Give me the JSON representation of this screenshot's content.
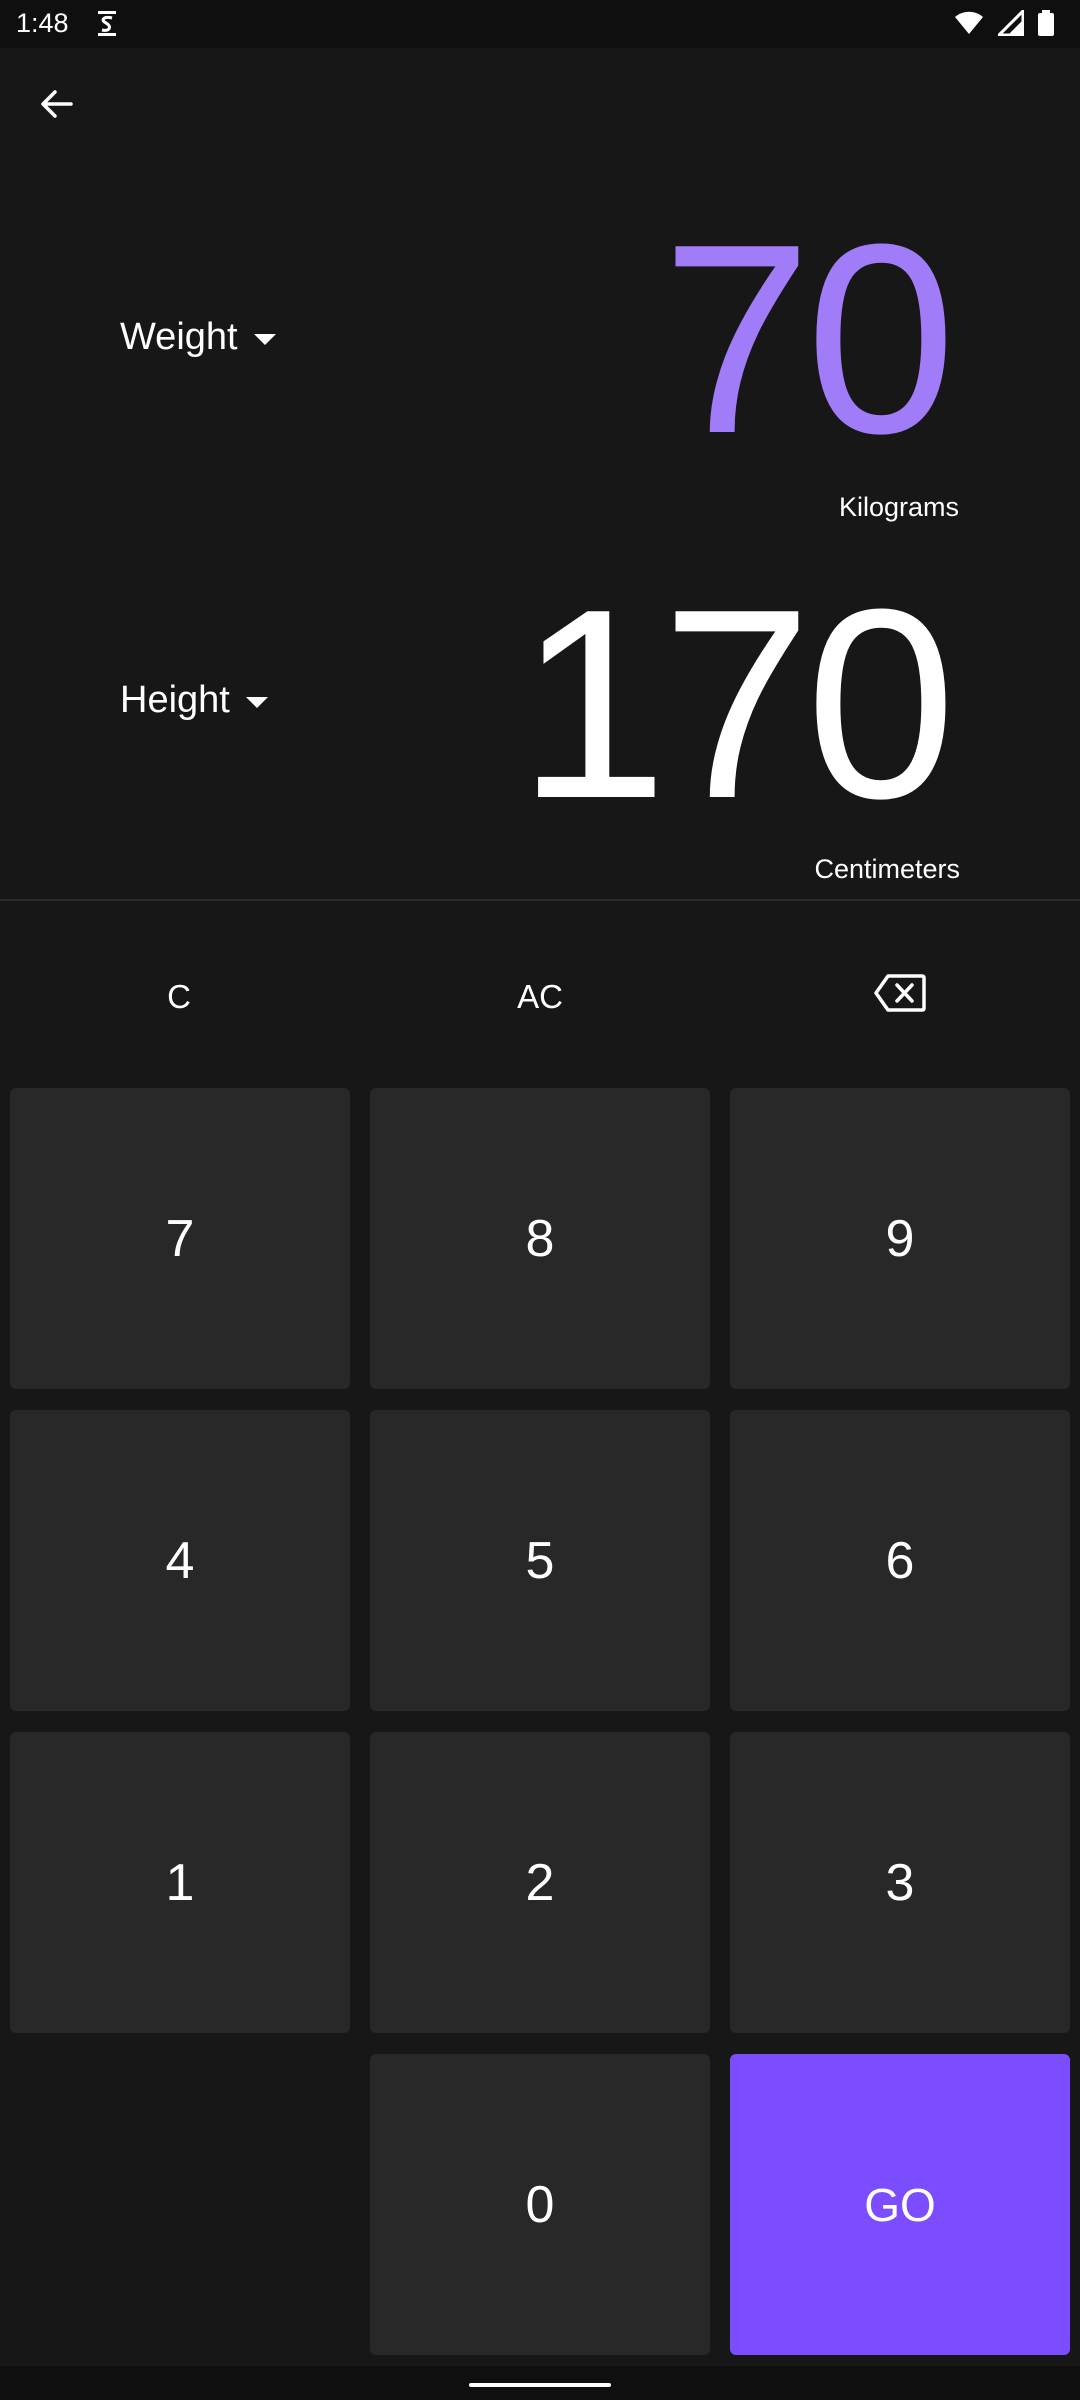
{
  "status_bar": {
    "time": "1:48",
    "icons": [
      "s-icon",
      "wifi-icon",
      "signal-icon",
      "battery-icon"
    ]
  },
  "app_bar": {
    "back_icon": "arrow-left-icon"
  },
  "weight": {
    "label": "Weight",
    "value": "70",
    "unit": "Kilograms",
    "color": "#a07cf8"
  },
  "height": {
    "label": "Height",
    "value": "170",
    "unit": "Centimeters",
    "color": "#ffffff"
  },
  "functions": {
    "clear": "C",
    "all_clear": "AC",
    "backspace_icon": "backspace-icon"
  },
  "keypad": {
    "k7": "7",
    "k8": "8",
    "k9": "9",
    "k4": "4",
    "k5": "5",
    "k6": "6",
    "k1": "1",
    "k2": "2",
    "k3": "3",
    "k0": "0",
    "go": "GO"
  },
  "colors": {
    "accent": "#7c4dff",
    "background": "#171717",
    "key": "#282828"
  }
}
